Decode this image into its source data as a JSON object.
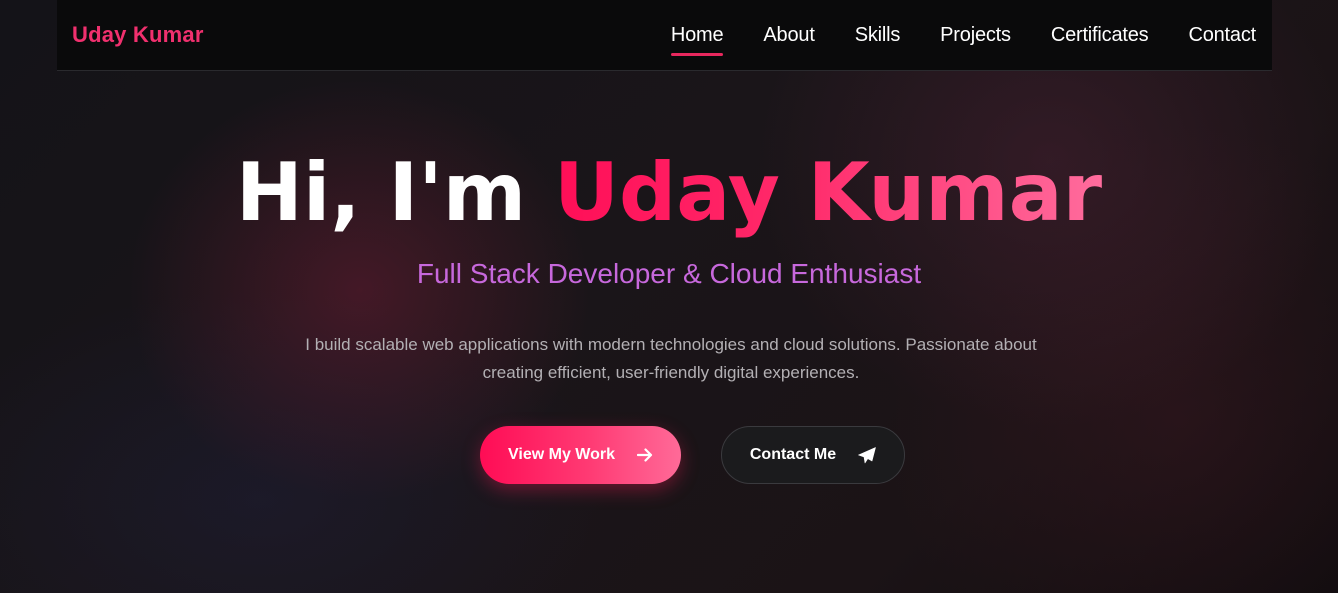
{
  "nav": {
    "logo": "Uday Kumar",
    "links": [
      {
        "label": "Home",
        "active": true
      },
      {
        "label": "About"
      },
      {
        "label": "Skills"
      },
      {
        "label": "Projects"
      },
      {
        "label": "Certificates"
      },
      {
        "label": "Contact"
      }
    ]
  },
  "hero": {
    "greeting": "Hi, I'm ",
    "name": "Uday Kumar",
    "subtitle": "Full Stack Developer & Cloud Enthusiast",
    "description": "I build scalable web applications with modern technologies and cloud solutions. Passionate about creating efficient, user-friendly digital experiences.",
    "primary_button": {
      "label": "View My Work",
      "icon": "arrow-right-icon"
    },
    "secondary_button": {
      "label": "Contact Me",
      "icon": "paper-plane-icon"
    }
  },
  "colors": {
    "accent": "#ff1f66",
    "subtitle": "#c768dc",
    "nav_background": "#0a0a0b",
    "page_background": "#141318"
  }
}
